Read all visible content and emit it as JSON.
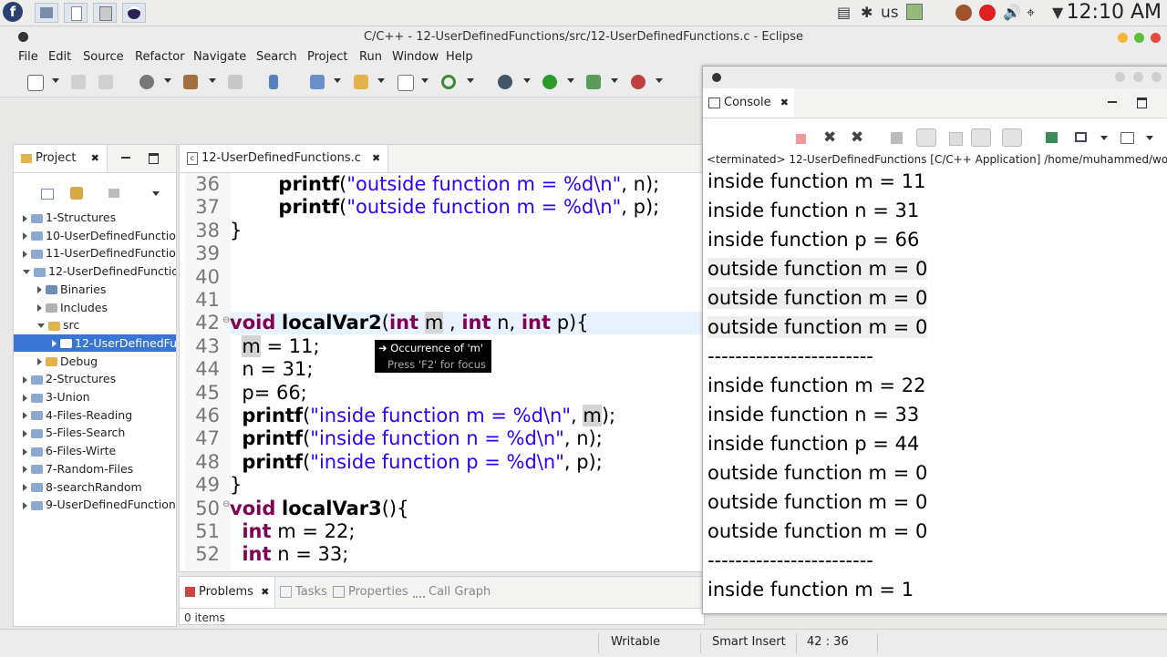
{
  "top_panel": {
    "keyboard_layout": "us",
    "clock": "12:10 AM"
  },
  "window": {
    "title": "C/C++ - 12-UserDefinedFunctions/src/12-UserDefinedFunctions.c - Eclipse"
  },
  "menubar": {
    "items": [
      "File",
      "Edit",
      "Source",
      "Refactor",
      "Navigate",
      "Search",
      "Project",
      "Run",
      "Window",
      "Help"
    ]
  },
  "project_explorer": {
    "tab_label": "Project",
    "items": [
      {
        "label": "1-Structures",
        "depth": 0,
        "state": "closed"
      },
      {
        "label": "10-UserDefinedFunctio",
        "depth": 0,
        "state": "closed"
      },
      {
        "label": "11-UserDefinedFunctio",
        "depth": 0,
        "state": "closed"
      },
      {
        "label": "12-UserDefinedFunctio",
        "depth": 0,
        "state": "open"
      },
      {
        "label": "Binaries",
        "depth": 1,
        "state": "closed"
      },
      {
        "label": "Includes",
        "depth": 1,
        "state": "closed"
      },
      {
        "label": "src",
        "depth": 1,
        "state": "open"
      },
      {
        "label": "12-UserDefinedFu",
        "depth": 2,
        "state": "closed",
        "selected": true
      },
      {
        "label": "Debug",
        "depth": 1,
        "state": "closed"
      },
      {
        "label": "2-Structures",
        "depth": 0,
        "state": "closed"
      },
      {
        "label": "3-Union",
        "depth": 0,
        "state": "closed"
      },
      {
        "label": "4-Files-Reading",
        "depth": 0,
        "state": "closed"
      },
      {
        "label": "5-Files-Search",
        "depth": 0,
        "state": "closed"
      },
      {
        "label": "6-Files-Wirte",
        "depth": 0,
        "state": "closed"
      },
      {
        "label": "7-Random-Files",
        "depth": 0,
        "state": "closed"
      },
      {
        "label": "8-searchRandom",
        "depth": 0,
        "state": "closed"
      },
      {
        "label": "9-UserDefinedFunction",
        "depth": 0,
        "state": "closed"
      }
    ]
  },
  "editor": {
    "tab_label": "12-UserDefinedFunctions.c",
    "tooltip_title": "Occurrence of 'm'",
    "tooltip_hint": "Press 'F2' for focus",
    "line_numbers": [
      "36",
      "37",
      "38",
      "39",
      "40",
      "41",
      "42",
      "43",
      "44",
      "45",
      "46",
      "47",
      "48",
      "49",
      "50",
      "51",
      "52"
    ],
    "lines": [
      {
        "indent": "        ",
        "tokens": [
          {
            "t": "printf",
            "c": "fn"
          },
          {
            "t": "(",
            "c": ""
          },
          {
            "t": "\"outside function m = %d\\n\"",
            "c": "str"
          },
          {
            "t": ", n);",
            "c": ""
          }
        ]
      },
      {
        "indent": "        ",
        "tokens": [
          {
            "t": "printf",
            "c": "fn"
          },
          {
            "t": "(",
            "c": ""
          },
          {
            "t": "\"outside function m = %d\\n\"",
            "c": "str"
          },
          {
            "t": ", p);",
            "c": ""
          }
        ]
      },
      {
        "indent": "",
        "tokens": [
          {
            "t": "}",
            "c": ""
          }
        ]
      },
      {
        "indent": "",
        "tokens": []
      },
      {
        "indent": "",
        "tokens": []
      },
      {
        "indent": "",
        "tokens": []
      },
      {
        "indent": "",
        "tokens": [
          {
            "t": "void",
            "c": "kw"
          },
          {
            "t": " ",
            "c": ""
          },
          {
            "t": "localVar2",
            "c": "fn"
          },
          {
            "t": "(",
            "c": ""
          },
          {
            "t": "int",
            "c": "kw"
          },
          {
            "t": " ",
            "c": ""
          },
          {
            "t": "m",
            "c": "occ"
          },
          {
            "t": " , ",
            "c": ""
          },
          {
            "t": "int",
            "c": "kw"
          },
          {
            "t": " n, ",
            "c": ""
          },
          {
            "t": "int",
            "c": "kw"
          },
          {
            "t": " p){",
            "c": ""
          }
        ]
      },
      {
        "indent": "  ",
        "tokens": [
          {
            "t": "m",
            "c": "occ"
          },
          {
            "t": " = 11;",
            "c": ""
          }
        ]
      },
      {
        "indent": "  ",
        "tokens": [
          {
            "t": "n = 31;",
            "c": ""
          }
        ]
      },
      {
        "indent": "  ",
        "tokens": [
          {
            "t": "p= 66;",
            "c": ""
          }
        ]
      },
      {
        "indent": "  ",
        "tokens": [
          {
            "t": "printf",
            "c": "fn"
          },
          {
            "t": "(",
            "c": ""
          },
          {
            "t": "\"inside function m = %d\\n\"",
            "c": "str"
          },
          {
            "t": ", ",
            "c": ""
          },
          {
            "t": "m",
            "c": "occ"
          },
          {
            "t": ");",
            "c": ""
          }
        ]
      },
      {
        "indent": "  ",
        "tokens": [
          {
            "t": "printf",
            "c": "fn"
          },
          {
            "t": "(",
            "c": ""
          },
          {
            "t": "\"inside function n = %d\\n\"",
            "c": "str"
          },
          {
            "t": ", n);",
            "c": ""
          }
        ]
      },
      {
        "indent": "  ",
        "tokens": [
          {
            "t": "printf",
            "c": "fn"
          },
          {
            "t": "(",
            "c": ""
          },
          {
            "t": "\"inside function p = %d\\n\"",
            "c": "str"
          },
          {
            "t": ", p);",
            "c": ""
          }
        ]
      },
      {
        "indent": "",
        "tokens": [
          {
            "t": "}",
            "c": ""
          }
        ]
      },
      {
        "indent": "",
        "tokens": [
          {
            "t": "void",
            "c": "kw"
          },
          {
            "t": " ",
            "c": ""
          },
          {
            "t": "localVar3",
            "c": "fn"
          },
          {
            "t": "(){",
            "c": ""
          }
        ]
      },
      {
        "indent": "  ",
        "tokens": [
          {
            "t": "int",
            "c": "kw"
          },
          {
            "t": " m = 22;",
            "c": ""
          }
        ]
      },
      {
        "indent": "  ",
        "tokens": [
          {
            "t": "int",
            "c": "kw"
          },
          {
            "t": " n = 33;",
            "c": ""
          }
        ]
      }
    ]
  },
  "bottom_panel": {
    "tabs": [
      "Problems",
      "Tasks",
      "Properties",
      "Call Graph"
    ],
    "items_text": "0 items"
  },
  "console": {
    "tab_label": "Console",
    "terminated_text": "<terminated> 12-UserDefinedFunctions [C/C++ Application] /home/muhammed/wo",
    "lines": [
      {
        "text": "inside function m = 11",
        "hl": false
      },
      {
        "text": "inside function n = 31",
        "hl": false
      },
      {
        "text": "inside function p = 66",
        "hl": false
      },
      {
        "text": "outside function m = 0",
        "hl": true
      },
      {
        "text": "outside function m = 0",
        "hl": true
      },
      {
        "text": "outside function m = 0",
        "hl": true
      },
      {
        "text": "------------------------",
        "hl": false
      },
      {
        "text": "inside function m = 22",
        "hl": false
      },
      {
        "text": "inside function n = 33",
        "hl": false
      },
      {
        "text": "inside function p = 44",
        "hl": false
      },
      {
        "text": "outside function m = 0",
        "hl": false
      },
      {
        "text": "outside function m = 0",
        "hl": false
      },
      {
        "text": "outside function m = 0",
        "hl": false
      },
      {
        "text": "------------------------",
        "hl": false
      },
      {
        "text": "inside function m = 1",
        "hl": false
      }
    ]
  },
  "status_bar": {
    "writable": "Writable",
    "insert_mode": "Smart Insert",
    "position": "42 : 36"
  },
  "colors": {
    "keyword": "#7f0055",
    "string": "#2a00ff",
    "selection": "#3875d7"
  }
}
